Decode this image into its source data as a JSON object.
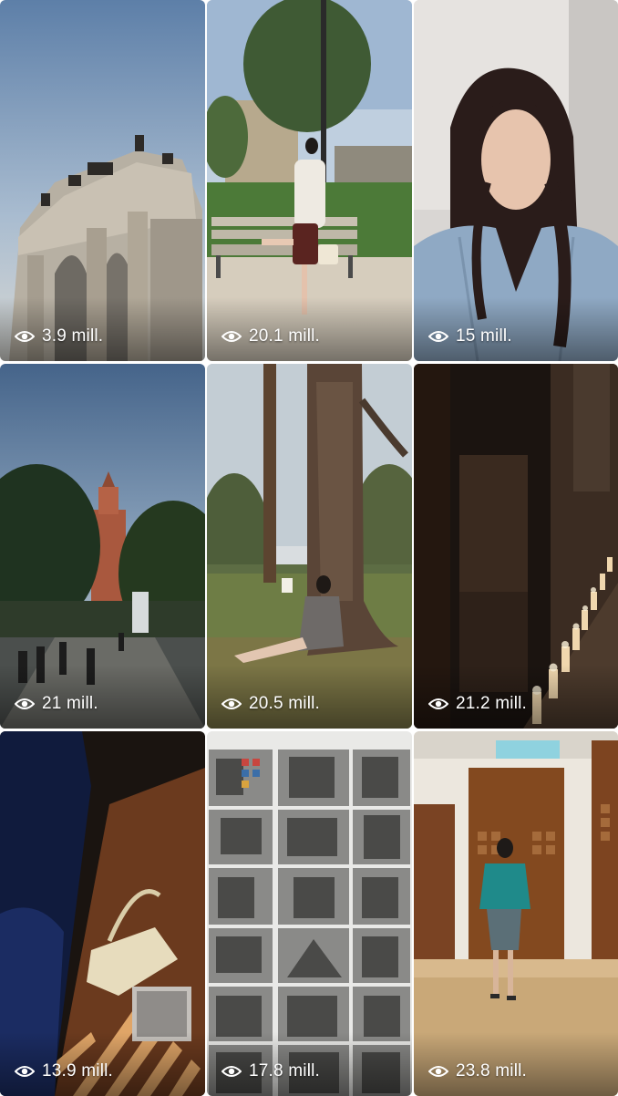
{
  "grid": {
    "tiles": [
      {
        "views": "3.9 mill.",
        "icon": "eye-icon",
        "scene": "arch-monument"
      },
      {
        "views": "20.1 mill.",
        "icon": "eye-icon",
        "scene": "woman-bench-park"
      },
      {
        "views": "15 mill.",
        "icon": "eye-icon",
        "scene": "woman-portrait"
      },
      {
        "views": "21 mill.",
        "icon": "eye-icon",
        "scene": "castle-tower-park"
      },
      {
        "views": "20.5 mill.",
        "icon": "eye-icon",
        "scene": "woman-under-tree"
      },
      {
        "views": "21.2 mill.",
        "icon": "eye-icon",
        "scene": "candles-corridor"
      },
      {
        "views": "13.9 mill.",
        "icon": "eye-icon",
        "scene": "handbag-shadows"
      },
      {
        "views": "17.8 mill.",
        "icon": "eye-icon",
        "scene": "photo-moodboard"
      },
      {
        "views": "23.8 mill.",
        "icon": "eye-icon",
        "scene": "runway-model"
      }
    ]
  }
}
